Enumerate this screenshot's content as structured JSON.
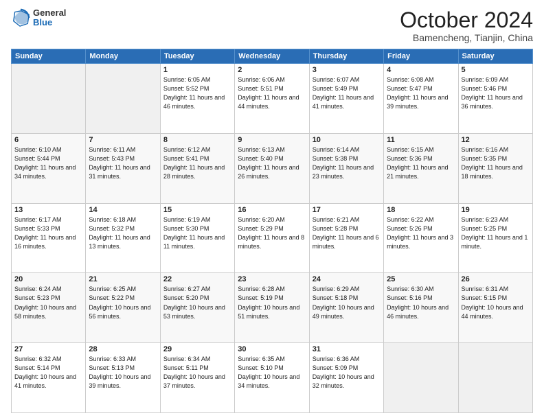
{
  "logo": {
    "general": "General",
    "blue": "Blue"
  },
  "header": {
    "month": "October 2024",
    "location": "Bamencheng, Tianjin, China"
  },
  "weekdays": [
    "Sunday",
    "Monday",
    "Tuesday",
    "Wednesday",
    "Thursday",
    "Friday",
    "Saturday"
  ],
  "weeks": [
    [
      null,
      null,
      {
        "day": 1,
        "sunrise": "6:05 AM",
        "sunset": "5:52 PM",
        "daylight": "11 hours and 46 minutes."
      },
      {
        "day": 2,
        "sunrise": "6:06 AM",
        "sunset": "5:51 PM",
        "daylight": "11 hours and 44 minutes."
      },
      {
        "day": 3,
        "sunrise": "6:07 AM",
        "sunset": "5:49 PM",
        "daylight": "11 hours and 41 minutes."
      },
      {
        "day": 4,
        "sunrise": "6:08 AM",
        "sunset": "5:47 PM",
        "daylight": "11 hours and 39 minutes."
      },
      {
        "day": 5,
        "sunrise": "6:09 AM",
        "sunset": "5:46 PM",
        "daylight": "11 hours and 36 minutes."
      }
    ],
    [
      {
        "day": 6,
        "sunrise": "6:10 AM",
        "sunset": "5:44 PM",
        "daylight": "11 hours and 34 minutes."
      },
      {
        "day": 7,
        "sunrise": "6:11 AM",
        "sunset": "5:43 PM",
        "daylight": "11 hours and 31 minutes."
      },
      {
        "day": 8,
        "sunrise": "6:12 AM",
        "sunset": "5:41 PM",
        "daylight": "11 hours and 28 minutes."
      },
      {
        "day": 9,
        "sunrise": "6:13 AM",
        "sunset": "5:40 PM",
        "daylight": "11 hours and 26 minutes."
      },
      {
        "day": 10,
        "sunrise": "6:14 AM",
        "sunset": "5:38 PM",
        "daylight": "11 hours and 23 minutes."
      },
      {
        "day": 11,
        "sunrise": "6:15 AM",
        "sunset": "5:36 PM",
        "daylight": "11 hours and 21 minutes."
      },
      {
        "day": 12,
        "sunrise": "6:16 AM",
        "sunset": "5:35 PM",
        "daylight": "11 hours and 18 minutes."
      }
    ],
    [
      {
        "day": 13,
        "sunrise": "6:17 AM",
        "sunset": "5:33 PM",
        "daylight": "11 hours and 16 minutes."
      },
      {
        "day": 14,
        "sunrise": "6:18 AM",
        "sunset": "5:32 PM",
        "daylight": "11 hours and 13 minutes."
      },
      {
        "day": 15,
        "sunrise": "6:19 AM",
        "sunset": "5:30 PM",
        "daylight": "11 hours and 11 minutes."
      },
      {
        "day": 16,
        "sunrise": "6:20 AM",
        "sunset": "5:29 PM",
        "daylight": "11 hours and 8 minutes."
      },
      {
        "day": 17,
        "sunrise": "6:21 AM",
        "sunset": "5:28 PM",
        "daylight": "11 hours and 6 minutes."
      },
      {
        "day": 18,
        "sunrise": "6:22 AM",
        "sunset": "5:26 PM",
        "daylight": "11 hours and 3 minutes."
      },
      {
        "day": 19,
        "sunrise": "6:23 AM",
        "sunset": "5:25 PM",
        "daylight": "11 hours and 1 minute."
      }
    ],
    [
      {
        "day": 20,
        "sunrise": "6:24 AM",
        "sunset": "5:23 PM",
        "daylight": "10 hours and 58 minutes."
      },
      {
        "day": 21,
        "sunrise": "6:25 AM",
        "sunset": "5:22 PM",
        "daylight": "10 hours and 56 minutes."
      },
      {
        "day": 22,
        "sunrise": "6:27 AM",
        "sunset": "5:20 PM",
        "daylight": "10 hours and 53 minutes."
      },
      {
        "day": 23,
        "sunrise": "6:28 AM",
        "sunset": "5:19 PM",
        "daylight": "10 hours and 51 minutes."
      },
      {
        "day": 24,
        "sunrise": "6:29 AM",
        "sunset": "5:18 PM",
        "daylight": "10 hours and 49 minutes."
      },
      {
        "day": 25,
        "sunrise": "6:30 AM",
        "sunset": "5:16 PM",
        "daylight": "10 hours and 46 minutes."
      },
      {
        "day": 26,
        "sunrise": "6:31 AM",
        "sunset": "5:15 PM",
        "daylight": "10 hours and 44 minutes."
      }
    ],
    [
      {
        "day": 27,
        "sunrise": "6:32 AM",
        "sunset": "5:14 PM",
        "daylight": "10 hours and 41 minutes."
      },
      {
        "day": 28,
        "sunrise": "6:33 AM",
        "sunset": "5:13 PM",
        "daylight": "10 hours and 39 minutes."
      },
      {
        "day": 29,
        "sunrise": "6:34 AM",
        "sunset": "5:11 PM",
        "daylight": "10 hours and 37 minutes."
      },
      {
        "day": 30,
        "sunrise": "6:35 AM",
        "sunset": "5:10 PM",
        "daylight": "10 hours and 34 minutes."
      },
      {
        "day": 31,
        "sunrise": "6:36 AM",
        "sunset": "5:09 PM",
        "daylight": "10 hours and 32 minutes."
      },
      null,
      null
    ]
  ]
}
